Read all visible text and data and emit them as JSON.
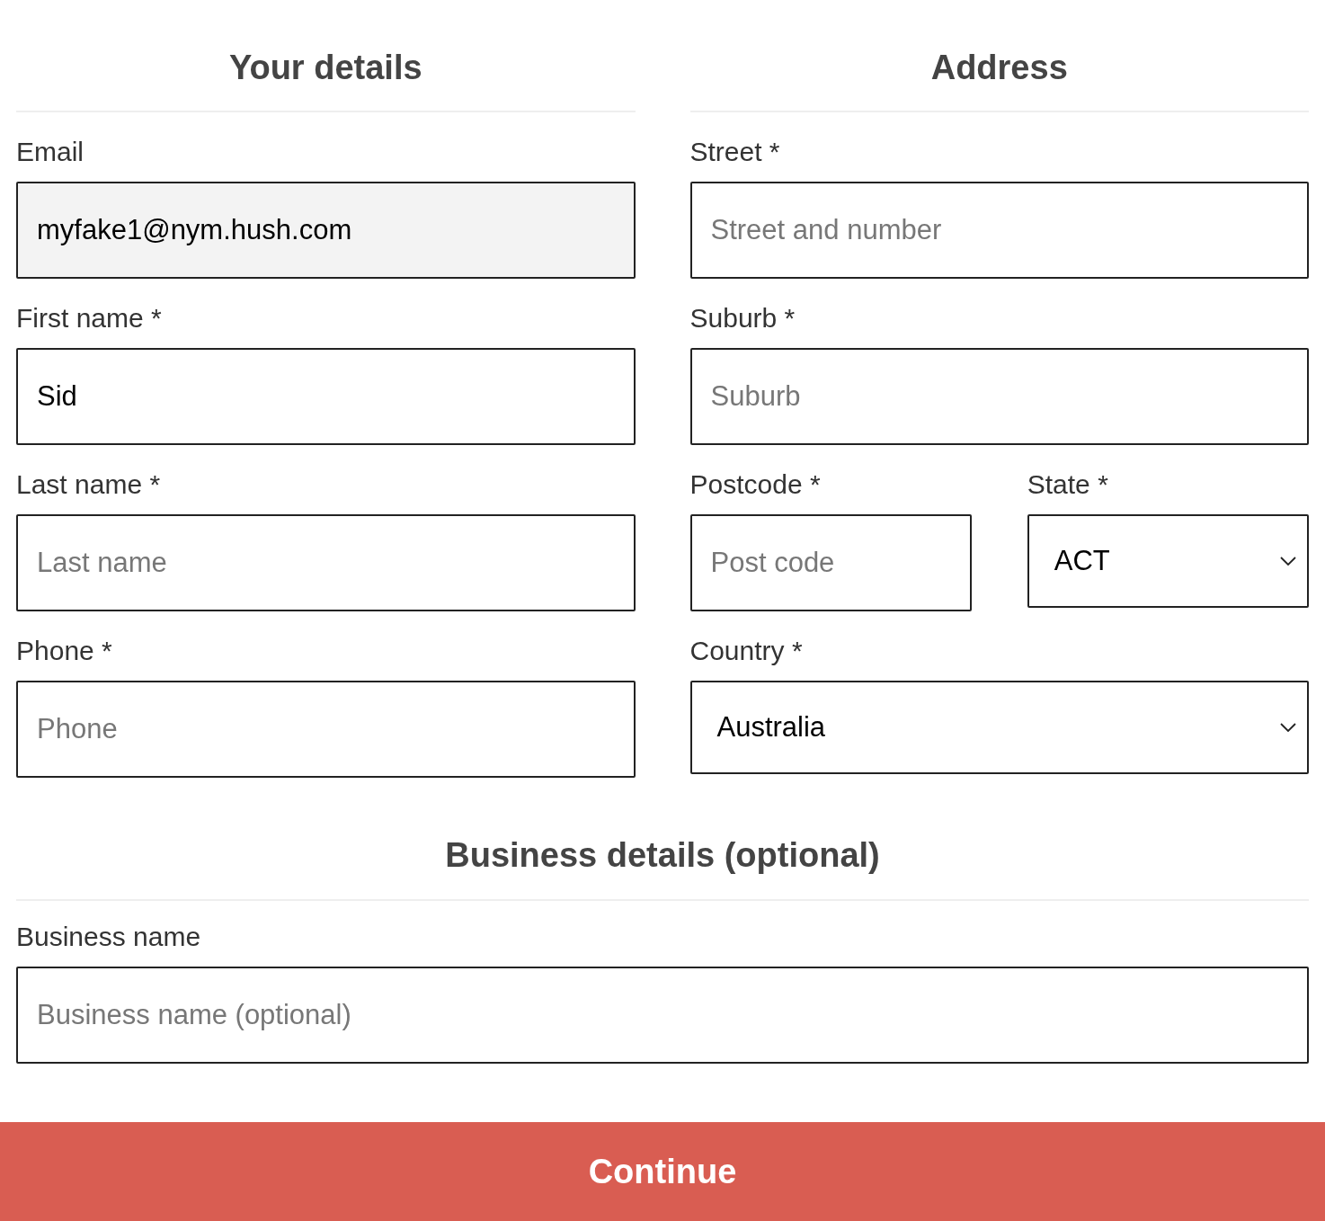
{
  "columns": [
    {
      "title": "Your details",
      "rows": [
        [
          {
            "kind": "input",
            "label": "Email",
            "value": "myfake1@nym.hush.com",
            "disabled": true
          }
        ],
        [
          {
            "kind": "input",
            "label": "First name *",
            "value": "Sid",
            "disabled": false
          }
        ],
        [
          {
            "kind": "input",
            "label": "Last name *",
            "placeholder": "Last name",
            "disabled": false
          }
        ],
        [
          {
            "kind": "input",
            "label": "Phone *",
            "placeholder": "Phone",
            "disabled": false
          }
        ]
      ]
    },
    {
      "title": "Address",
      "rows": [
        [
          {
            "kind": "input",
            "label": "Street *",
            "placeholder": "Street and number",
            "disabled": false
          }
        ],
        [
          {
            "kind": "input",
            "label": "Suburb *",
            "placeholder": "Suburb",
            "disabled": false
          }
        ],
        [
          {
            "kind": "input",
            "label": "Postcode *",
            "placeholder": "Post code",
            "disabled": false
          },
          {
            "kind": "select",
            "label": "State *",
            "value": "ACT",
            "disabled": false
          }
        ],
        [
          {
            "kind": "select",
            "label": "Country *",
            "value": "Australia",
            "disabled": false
          }
        ]
      ]
    }
  ],
  "business": {
    "title": "Business details (optional)",
    "rows": [
      [
        {
          "kind": "input",
          "label": "Business name",
          "placeholder": "Business name (optional)",
          "disabled": false
        }
      ]
    ]
  },
  "button": "Continue"
}
